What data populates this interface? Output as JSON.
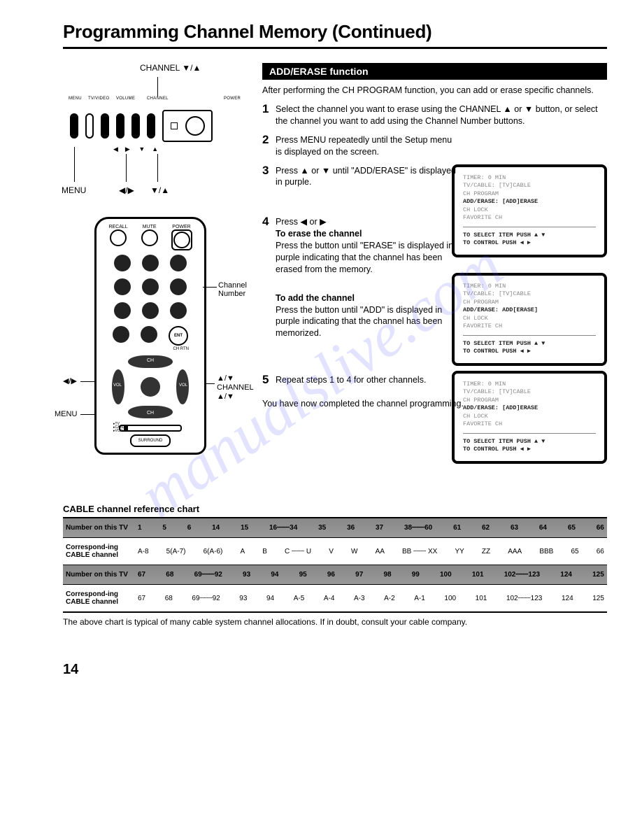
{
  "title": "Programming Channel Memory (Continued)",
  "watermark": "manualslive.com",
  "page_number": "14",
  "top_diagram": {
    "caption_top": "CHANNEL ▼/▲",
    "buttons": [
      "MENU",
      "TV/VIDEO",
      "VOLUME",
      "CHANNEL",
      "POWER"
    ],
    "bottom_left": "MENU",
    "bottom_arrows_1": "◀/▶",
    "bottom_arrows_2": "▼/▲"
  },
  "remote_diagram": {
    "top_labels": [
      "RECALL",
      "MUTE",
      "POWER"
    ],
    "ent": "ENT",
    "chrtn": "CH RTN",
    "surround": "SURROUND",
    "slider_labels": [
      "TV",
      "CABLE",
      "VCR"
    ],
    "callout_numpad": "Channel\nNumber",
    "callout_lr": "◀/▶",
    "callout_updown_right": "▲/▼\nCHANNEL\n▲/▼",
    "callout_menu": "MENU",
    "dpad_labels": {
      "up": "CH",
      "down": "CH",
      "left": "VOL",
      "right": "VOL"
    }
  },
  "function_bar": "ADD/ERASE function",
  "intro": "After performing the CH PROGRAM function, you can add or erase specific channels.",
  "steps": {
    "s1": "Select the channel you want to erase using the CHANNEL ▲ or ▼ button, or select the channel you want to add using the Channel Number buttons.",
    "s2": "Press MENU repeatedly until the Setup menu is displayed on the screen.",
    "s3": "Press ▲ or ▼ until \"ADD/ERASE\" is displayed in purple.",
    "s4_a": "Press ◀ or ▶",
    "s4_erase_h": "To erase the channel",
    "s4_erase_b": "Press the button until \"ERASE\" is displayed in purple indicating that the channel has been erased from the memory.",
    "s4_add_h": "To add the channel",
    "s4_add_b": "Press the button until \"ADD\" is displayed in purple indicating that the channel has been memorized.",
    "s5": "Repeat steps 1 to 4 for other channels."
  },
  "completed": "You have now completed the channel programming.",
  "osd": {
    "line_timer": "TIMER:          0 MIN",
    "line_tvcable": "TV/CABLE:      [TV]CABLE",
    "line_chprog": "CH PROGRAM",
    "line_chlock": "CH LOCK",
    "line_fav": "FAVORITE CH",
    "select": "TO SELECT ITEM PUSH ▲ ▼",
    "control": "TO CONTROL PUSH ◀ ▶",
    "add_erase_1": "ADD/ERASE:    [ADD]ERASE",
    "add_erase_2": "ADD/ERASE:    ADD[ERASE]",
    "add_erase_3": "ADD/ERASE:    [ADD]ERASE"
  },
  "chart_section": {
    "heading": "CABLE channel reference chart",
    "row1_label": "Number on this TV",
    "row2_label": "Correspond-ing CABLE channel",
    "footer": "The above chart is typical of many cable system channel allocations. If in doubt, consult your cable company."
  },
  "chart_data": {
    "type": "table",
    "title": "CABLE channel reference chart",
    "rows": [
      {
        "label": "Number on this TV",
        "cells": [
          "1",
          "5",
          "6",
          "14",
          "15",
          "16┄┄┄34",
          "35",
          "36",
          "37",
          "38┄┄┄60",
          "61",
          "62",
          "63",
          "64",
          "65",
          "66"
        ]
      },
      {
        "label": "Corresponding CABLE channel",
        "cells": [
          "A-8",
          "5(A-7)",
          "6(A-6)",
          "A",
          "B",
          "C ┄┄┄ U",
          "V",
          "W",
          "AA",
          "BB ┄┄┄ XX",
          "YY",
          "ZZ",
          "AAA",
          "BBB",
          "65",
          "66"
        ]
      },
      {
        "label": "Number on this TV",
        "cells": [
          "67",
          "68",
          "69┄┄┄92",
          "93",
          "94",
          "95",
          "96",
          "97",
          "98",
          "99",
          "100",
          "101",
          "102┄┄┄123",
          "124",
          "125"
        ]
      },
      {
        "label": "Corresponding CABLE channel",
        "cells": [
          "67",
          "68",
          "69┄┄┄92",
          "93",
          "94",
          "A-5",
          "A-4",
          "A-3",
          "A-2",
          "A-1",
          "100",
          "101",
          "102┄┄┄123",
          "124",
          "125"
        ]
      }
    ]
  }
}
